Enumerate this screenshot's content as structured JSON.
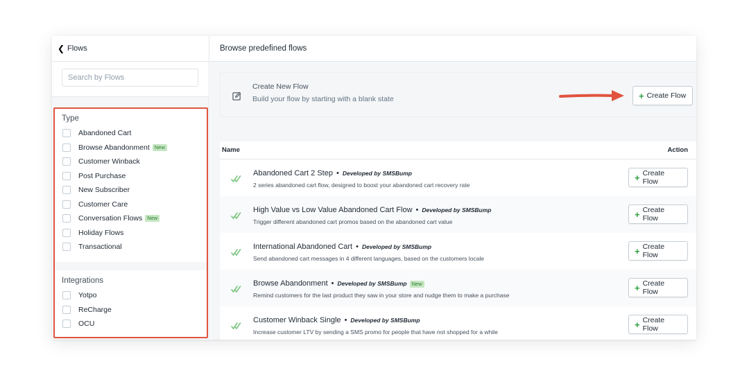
{
  "sidebar": {
    "back_label": "Flows",
    "search_placeholder": "Search by Flows",
    "type_title": "Type",
    "type_options": [
      {
        "label": "Abandoned Cart",
        "badge": ""
      },
      {
        "label": "Browse Abandonment",
        "badge": "New"
      },
      {
        "label": "Customer Winback",
        "badge": ""
      },
      {
        "label": "Post Purchase",
        "badge": ""
      },
      {
        "label": "New Subscriber",
        "badge": ""
      },
      {
        "label": "Customer Care",
        "badge": ""
      },
      {
        "label": "Conversation Flows",
        "badge": "New"
      },
      {
        "label": "Holiday Flows",
        "badge": ""
      },
      {
        "label": "Transactional",
        "badge": ""
      }
    ],
    "integrations_title": "Integrations",
    "integration_options": [
      {
        "label": "Yotpo"
      },
      {
        "label": "ReCharge"
      },
      {
        "label": "OCU"
      }
    ]
  },
  "main": {
    "title": "Browse predefined flows",
    "new_flow": {
      "title": "Create New Flow",
      "subtitle": "Build your flow by starting with a blank state",
      "button_label": "Create Flow"
    },
    "table": {
      "col_name": "Name",
      "col_action": "Action",
      "rows": [
        {
          "title": "Abandoned Cart 2 Step",
          "developer": "Developed by SMSBump",
          "badge": "",
          "description": "2 series abandoned cart flow, designed to boost your abandoned cart recovery rate",
          "button_label": "Create Flow"
        },
        {
          "title": "High Value vs Low Value Abandoned Cart Flow",
          "developer": "Developed by SMSBump",
          "badge": "",
          "description": "Trigger different abandoned cart promos based on the abandoned cart value",
          "button_label": "Create Flow"
        },
        {
          "title": "International Abandoned Cart",
          "developer": "Developed by SMSBump",
          "badge": "",
          "description": "Send abandoned cart messages in 4 different languages, based on the customers locale",
          "button_label": "Create Flow"
        },
        {
          "title": "Browse Abandonment",
          "developer": "Developed by SMSBump",
          "badge": "New",
          "description": "Remind customers for the last product they saw in your store and nudge them to make a purchase",
          "button_label": "Create Flow"
        },
        {
          "title": "Customer Winback Single",
          "developer": "Developed by SMSBump",
          "badge": "",
          "description": "Increase customer LTV by sending a SMS promo for people that have not shopped for a while",
          "button_label": "Create Flow"
        }
      ]
    }
  },
  "colors": {
    "accent_green": "#2e9f3e",
    "highlight_red": "#e1533f",
    "badge_bg": "#c5e6c1"
  }
}
